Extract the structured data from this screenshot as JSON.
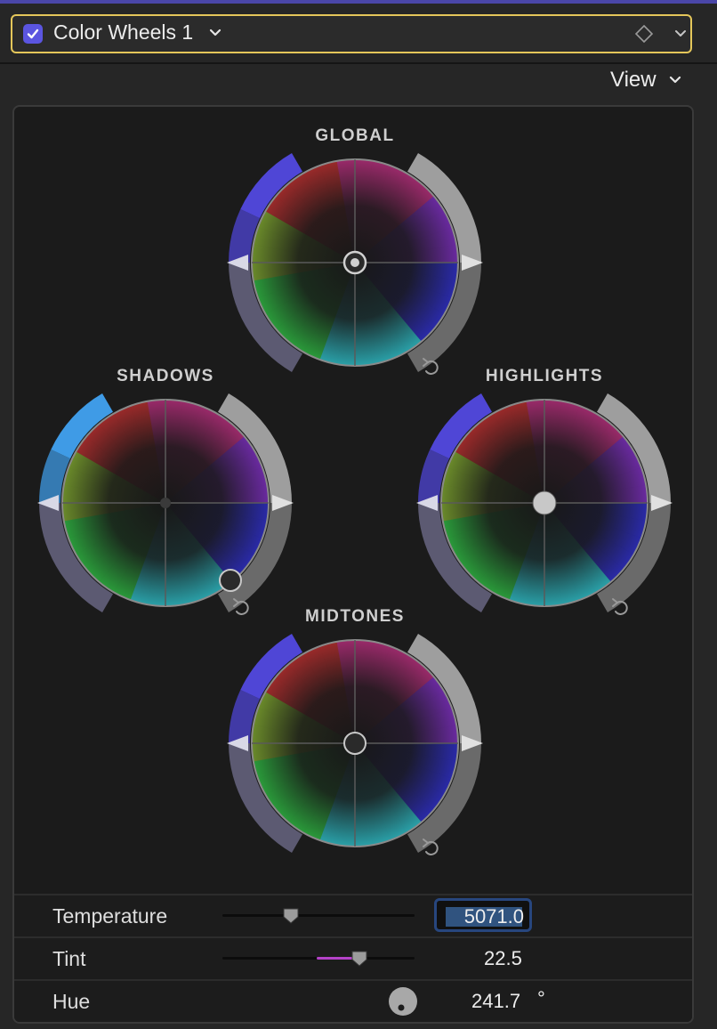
{
  "header": {
    "enabled": true,
    "title": "Color Wheels 1",
    "accent_color": "#e4c65a",
    "checkbox_color": "#5b55e0",
    "title_chevron_icon": "chevron-down-icon",
    "keyframe_icon": "diamond-outline-icon",
    "menu_chevron_icon": "chevron-down-icon"
  },
  "view_menu": {
    "label": "View",
    "icon": "chevron-down-icon"
  },
  "wheels": [
    {
      "id": "global",
      "label": "GLOBAL",
      "puck_style": "target",
      "reset_icon": "undo-arrow-icon"
    },
    {
      "id": "shadows",
      "label": "SHADOWS",
      "puck_style": "ring",
      "reset_icon": "undo-arrow-icon"
    },
    {
      "id": "highlights",
      "label": "HIGHLIGHTS",
      "puck_style": "solid",
      "reset_icon": "undo-arrow-icon"
    },
    {
      "id": "midtones",
      "label": "MIDTONES",
      "puck_style": "ring",
      "reset_icon": "undo-arrow-icon"
    }
  ],
  "parameters": {
    "temperature": {
      "label": "Temperature",
      "value": "5071.0",
      "slider_position": 0.35,
      "editing": true
    },
    "tint": {
      "label": "Tint",
      "value": "22.5",
      "slider_position": 0.71,
      "fill_color": "#b542c8"
    },
    "hue": {
      "label": "Hue",
      "value": "241.7",
      "unit": "°",
      "knob_icon": "dial-knob-icon"
    }
  }
}
